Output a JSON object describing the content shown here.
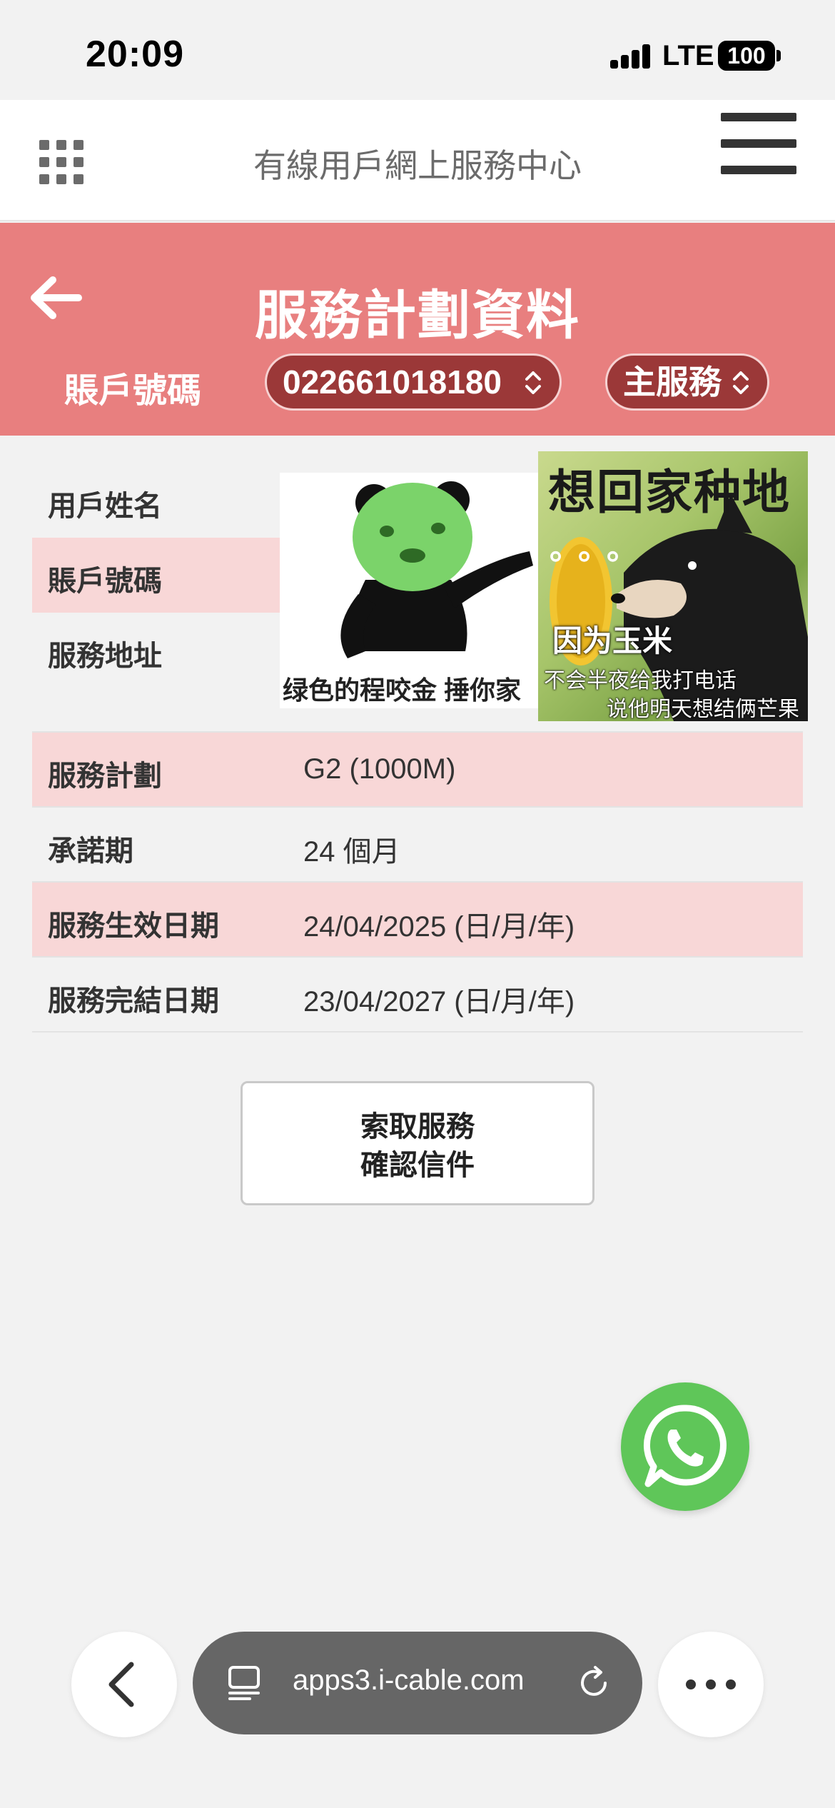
{
  "status_bar": {
    "time": "20:09",
    "network": "LTE",
    "battery": "100"
  },
  "header": {
    "title": "有線用戶網上服務中心"
  },
  "banner": {
    "page_title": "服務計劃資料",
    "account_label": "賬戶號碼",
    "account_select_value": "022661018180",
    "service_select_value": "主服務"
  },
  "info_rows": [
    {
      "label": "用戶姓名",
      "value": ""
    },
    {
      "label": "賬戶號碼",
      "value": ""
    },
    {
      "label": "服務地址",
      "value": ""
    },
    {
      "label": "服務計劃",
      "value": "G2 (1000M)"
    },
    {
      "label": "承諾期",
      "value": "24 個月"
    },
    {
      "label": "服務生效日期",
      "value": "24/04/2025 (日/月/年)"
    },
    {
      "label": "服務完結日期",
      "value": "23/04/2027 (日/月/年)"
    }
  ],
  "meme_left": {
    "caption": "绿色的程咬金 捶你家"
  },
  "meme_right": {
    "title": "想回家种地",
    "dots": "。。。",
    "caption_1": "因为玉米",
    "caption_2": "不会半夜给我打电话",
    "caption_3": "说他明天想结俩芒果"
  },
  "confirm_button": {
    "line1": "索取服務",
    "line2": "確認信件"
  },
  "browser": {
    "url": "apps3.i-cable.com"
  },
  "colors": {
    "banner": "#e87f7f",
    "pill": "#9b3838",
    "row_pink": "#f8d7d7",
    "whatsapp": "#5fc659"
  }
}
